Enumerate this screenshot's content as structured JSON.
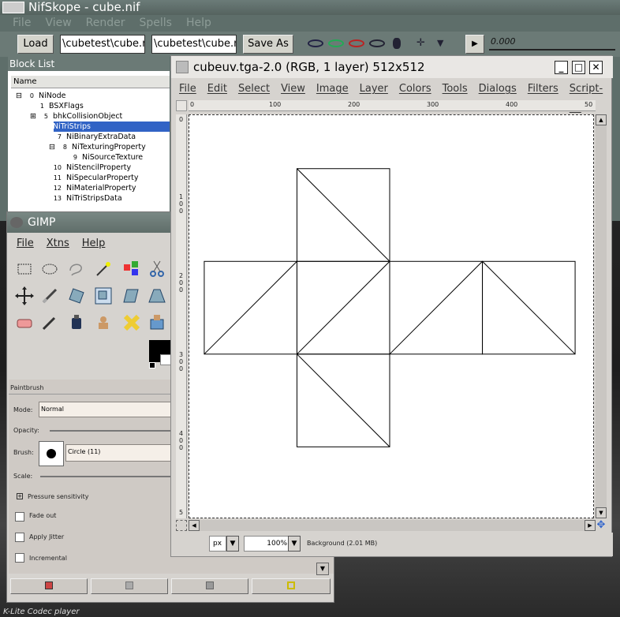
{
  "nifskope": {
    "title": "NifSkope - cube.nif",
    "menu": [
      "File",
      "View",
      "Render",
      "Spells",
      "Help"
    ],
    "load_label": "Load",
    "load_path": "\\cubetest\\cube.nif",
    "save_path": "\\cubetest\\cube.nif",
    "save_as_label": "Save As",
    "frame_value": "0.000",
    "block_list_title": "Block List",
    "column_name": "Name",
    "tree": [
      {
        "num": "0",
        "label": "NiNode"
      },
      {
        "num": "1",
        "label": "BSXFlags"
      },
      {
        "num": "5",
        "label": "bhkCollisionObject"
      },
      {
        "num": "6",
        "label": "NiTriStrips"
      },
      {
        "num": "7",
        "label": "NiBinaryExtraData"
      },
      {
        "num": "8",
        "label": "NiTexturingProperty"
      },
      {
        "num": "9",
        "label": "NiSourceTexture"
      },
      {
        "num": "10",
        "label": "NiStencilProperty"
      },
      {
        "num": "11",
        "label": "NiSpecularProperty"
      },
      {
        "num": "12",
        "label": "NiMaterialProperty"
      },
      {
        "num": "13",
        "label": "NiTriStripsData"
      }
    ]
  },
  "gimp_toolbox": {
    "title": "GIMP",
    "menu": [
      "File",
      "Xtns",
      "Help"
    ],
    "tool_name": "Paintbrush",
    "mode_label": "Mode:",
    "mode_value": "Normal",
    "opacity_label": "Opacity:",
    "brush_label": "Brush:",
    "brush_value": "Circle  (11)",
    "scale_label": "Scale:",
    "pressure_label": "Pressure  sensitivity",
    "fade_label": "Fade  out",
    "jitter_label": "Apply  Jitter",
    "incremental_label": "Incremental"
  },
  "image_window": {
    "title": "cubeuv.tga-2.0 (RGB, 1 layer) 512x512",
    "menu": [
      "File",
      "Edit",
      "Select",
      "View",
      "Image",
      "Layer",
      "Colors",
      "Tools",
      "Dialogs",
      "Filters",
      "Script-Fu"
    ],
    "ruler_h": [
      "0",
      "100",
      "200",
      "300",
      "400",
      "50"
    ],
    "ruler_v": [
      "0",
      "1 0 0",
      "2 0 0",
      "3 0 0",
      "4 0 0",
      "5"
    ],
    "unit": "px",
    "zoom": "100%",
    "status": "Background  (2.01  MB)"
  },
  "desktop": {
    "taskbar_text": "K-Lite Codec player"
  }
}
